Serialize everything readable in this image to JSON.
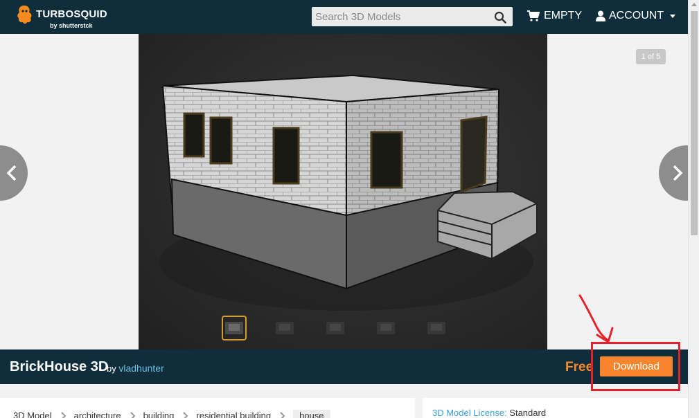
{
  "header": {
    "logo_name": "TURBOSQUID",
    "logo_sub": "by shutterstck",
    "search_placeholder": "Search 3D Models",
    "cart_label": "EMPTY",
    "account_label": "ACCOUNT"
  },
  "viewer": {
    "counter": "1 of 5",
    "thumbnail_count": 5,
    "active_thumbnail": 1
  },
  "product": {
    "title": "BrickHouse 3D",
    "by": "by",
    "author": "vladhunter",
    "price": "Free",
    "download_label": "Download"
  },
  "breadcrumb": {
    "items": [
      "3D Model",
      "architecture",
      "building",
      "residential building",
      "house"
    ]
  },
  "license": {
    "key": "3D Model License:",
    "value": "Standard"
  },
  "colors": {
    "header_bg": "#0f2d3b",
    "accent_orange": "#f7852d",
    "link_blue": "#6ec1e4",
    "annotation_red": "#e8202a"
  },
  "icons": {
    "search": "search-icon",
    "cart": "cart-icon",
    "user": "user-icon",
    "prev": "chevron-left-icon",
    "next": "chevron-right-icon"
  }
}
